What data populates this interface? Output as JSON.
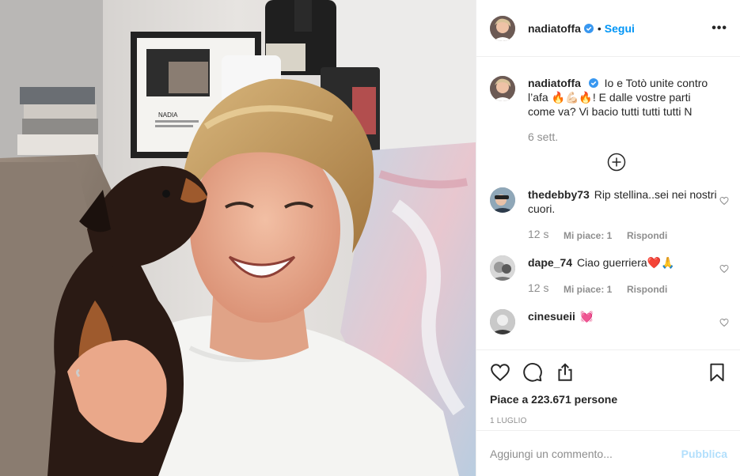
{
  "post": {
    "author": "nadiatoffa",
    "follow_label": "Segui",
    "separator": "•",
    "more_label": "•••",
    "photo_label": "NADIA"
  },
  "caption": {
    "username": "nadiatoffa",
    "text": "Io e Totò unite contro l’afa 🔥💪🏻🔥! E dalle vostre parti come va? Vi bacio tutti tutti tutti N",
    "time": "6 sett."
  },
  "comments": [
    {
      "username": "thedebby73",
      "text": "Rip stellina..sei nei nostri cuori.",
      "time": "12 s",
      "likes": "Mi piace: 1",
      "reply": "Rispondi"
    },
    {
      "username": "dape_74",
      "text": "Ciao guerriera❤️🙏",
      "time": "12 s",
      "likes": "Mi piace: 1",
      "reply": "Rispondi"
    },
    {
      "username": "cinesueii",
      "text": "💓"
    }
  ],
  "footer": {
    "likes_text": "Piace a 223.671 persone",
    "date": "1 LUGLIO",
    "comment_placeholder": "Aggiungi un commento...",
    "publish_label": "Pubblica"
  },
  "colors": {
    "accent": "#0095f6",
    "publish_disabled": "#b2dffc",
    "muted": "#8e8e8e",
    "text": "#262626",
    "border": "#efefef"
  },
  "icons": [
    "verified-icon",
    "more-icon",
    "load-more-icon",
    "heart-icon",
    "comment-icon",
    "share-icon",
    "save-icon"
  ]
}
